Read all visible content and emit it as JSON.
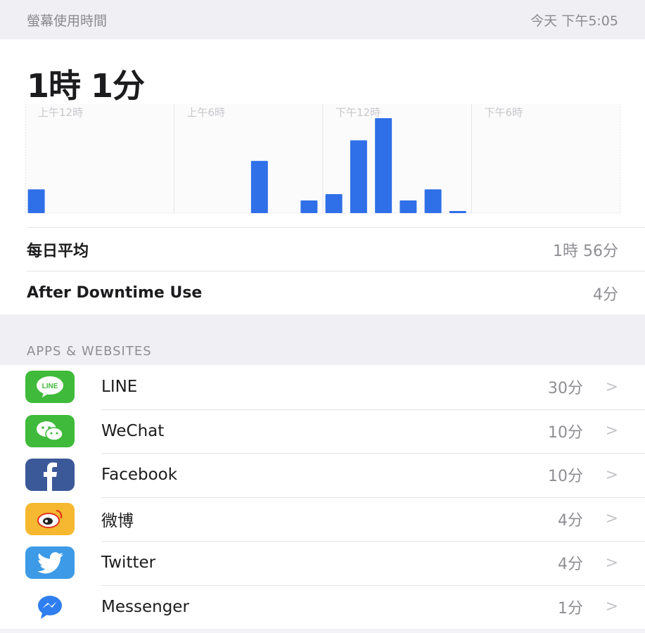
{
  "header": {
    "title": "螢幕使用時間",
    "date": "今天 下午5:05"
  },
  "summary": {
    "total": "1時 1分",
    "daily_avg_label": "每日平均",
    "daily_avg_value": "1時 56分",
    "after_downtime_label": "After Downtime Use",
    "after_downtime_value": "4分"
  },
  "chart_data": {
    "type": "bar",
    "x_tick_labels": [
      "上午12時",
      "上午6時",
      "下午12時",
      "下午6時"
    ],
    "hours": [
      0,
      1,
      2,
      3,
      4,
      5,
      6,
      7,
      8,
      9,
      10,
      11,
      12,
      13,
      14,
      15,
      16,
      17,
      18,
      19,
      20,
      21,
      22,
      23
    ],
    "values": [
      15,
      0,
      0,
      0,
      0,
      0,
      0,
      0,
      0,
      33,
      0,
      8,
      12,
      46,
      60,
      8,
      15,
      1,
      0,
      0,
      0,
      0,
      0,
      0
    ],
    "ylim": [
      0,
      60
    ],
    "bar_color": "#2f6fe8"
  },
  "section": {
    "title": "APPS & WEBSITES"
  },
  "apps": [
    {
      "name": "LINE",
      "time": "30分",
      "icon": "line-icon",
      "color": "#3fba3a"
    },
    {
      "name": "WeChat",
      "time": "10分",
      "icon": "wechat-icon",
      "color": "#3fba3a"
    },
    {
      "name": "Facebook",
      "time": "10分",
      "icon": "facebook-icon",
      "color": "#3b5998"
    },
    {
      "name": "微博",
      "time": "4分",
      "icon": "weibo-icon",
      "color": "#f5b830"
    },
    {
      "name": "Twitter",
      "time": "4分",
      "icon": "twitter-icon",
      "color": "#3c9ae6"
    },
    {
      "name": "Messenger",
      "time": "1分",
      "icon": "messenger-icon",
      "color": "#2f7ef0"
    }
  ]
}
